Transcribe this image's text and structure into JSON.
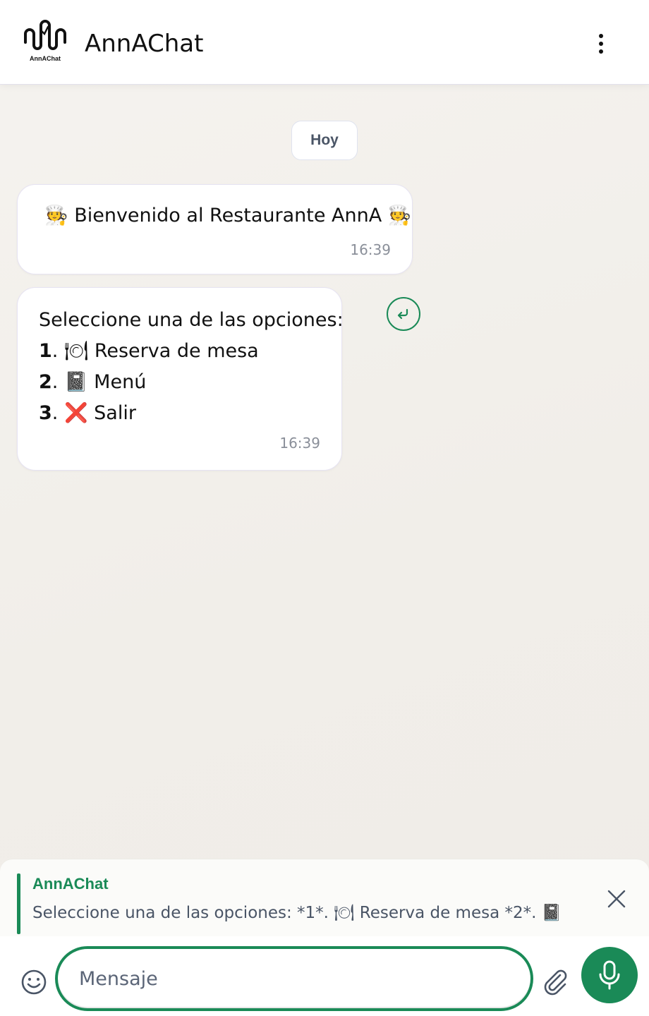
{
  "header": {
    "logo_text": "AnnAChat",
    "title": "AnnAChat"
  },
  "chat": {
    "date_label": "Hoy",
    "messages": [
      {
        "text": "🧑‍🍳 Bienvenido al Restaurante AnnA 🧑‍🍳",
        "time": "16:39"
      },
      {
        "intro": "Seleccione una de las opciones:",
        "options": [
          {
            "num": "1",
            "text": "🍽 Reserva de mesa"
          },
          {
            "num": "2",
            "text": "📓 Menú"
          },
          {
            "num": "3",
            "text": "❌ Salir"
          }
        ],
        "time": "16:39"
      }
    ]
  },
  "reply": {
    "author": "AnnAChat",
    "text": "Seleccione una de las opciones: *1*. 🍽 Reserva de mesa *2*. 📓 ..."
  },
  "composer": {
    "placeholder": "Mensaje"
  },
  "colors": {
    "accent": "#1a8a57",
    "timestamp": "#8a8f99"
  },
  "icons": {
    "menu": "more-vertical-icon",
    "reply": "reply-icon",
    "close": "close-icon",
    "emoji": "smiley-icon",
    "attach": "paperclip-icon",
    "mic": "microphone-icon"
  }
}
